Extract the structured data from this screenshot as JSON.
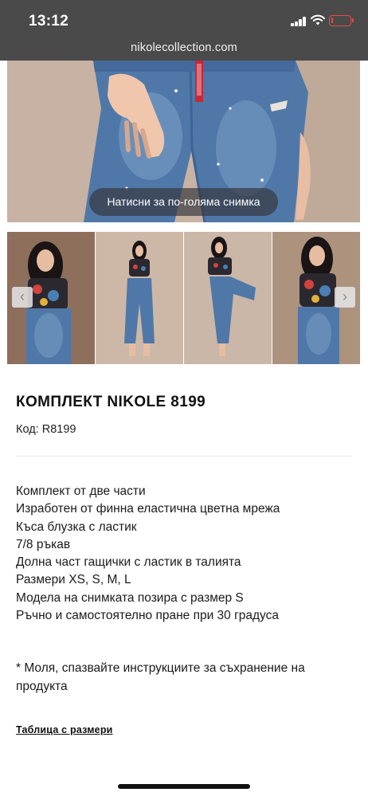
{
  "status_bar": {
    "time": "13:12",
    "battery_percent": 10,
    "battery_color": "#e84a4a"
  },
  "browser": {
    "url": "nikolecollection.com"
  },
  "gallery": {
    "zoom_hint": "Натисни за по-голяма снимка",
    "prev_icon": "chevron-left-icon",
    "next_icon": "chevron-right-icon"
  },
  "product": {
    "title": "КОМПЛЕКТ NIKOLE 8199",
    "code_label": "Код:",
    "code_value": "R8199",
    "description": [
      "Комплект от две части",
      "Изработен от финна еластична цветна мрежа",
      "Къса блузка с ластик",
      "7/8 ръкав",
      "Долна част гащички с ластик в талията",
      "Размери XS, S, M, L",
      "Модела на снимката позира с размер S",
      "Ръчно и самостоятелно пране при 30 градуса"
    ],
    "care_note": "* Моля, спазвайте инструкциите за съхранение на продукта",
    "size_table_link": "Таблица с размери"
  },
  "colors": {
    "status_bg": "#4a4a4a",
    "denim": "#4f78a8",
    "backdrop": "#c9b4a6"
  }
}
